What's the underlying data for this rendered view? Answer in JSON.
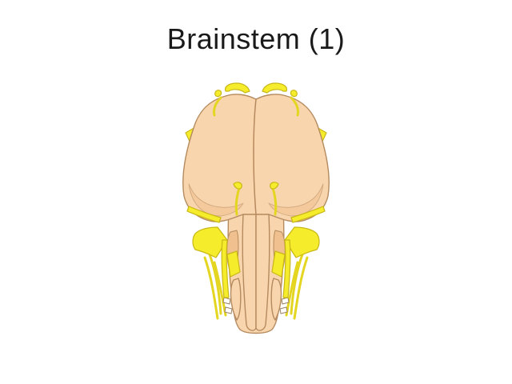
{
  "slide": {
    "title": "Brainstem (1)"
  },
  "illustration": {
    "subject": "brainstem",
    "colors": {
      "tissue_fill": "#F9D5AE",
      "tissue_shade": "#F0C08E",
      "outline": "#B58A5E",
      "nerve_fill": "#F5EC2C",
      "nerve_outline": "#C9B716"
    }
  }
}
